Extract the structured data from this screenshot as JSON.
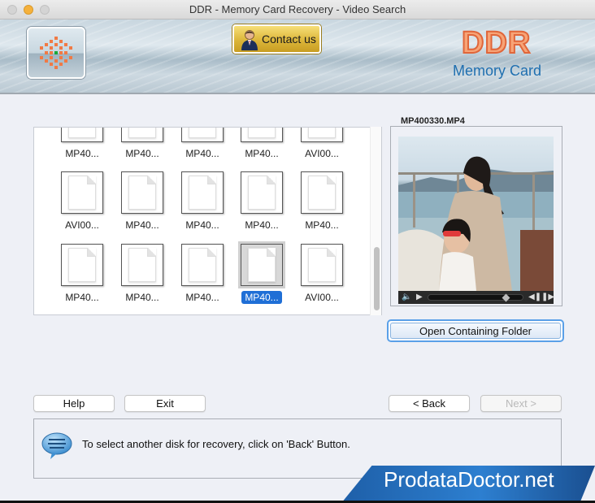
{
  "window": {
    "title": "DDR - Memory Card Recovery - Video Search"
  },
  "header": {
    "contact_label": "Contact us",
    "brand_title": "DDR",
    "brand_subtitle": "Memory Card",
    "brand_color": "#e0663a",
    "subtitle_color": "#1f6fb0"
  },
  "files": {
    "rows": [
      [
        "MP40...",
        "MP40...",
        "MP40...",
        "MP40...",
        "AVI00..."
      ],
      [
        "AVI00...",
        "MP40...",
        "MP40...",
        "MP40...",
        "MP40..."
      ],
      [
        "MP40...",
        "MP40...",
        "MP40...",
        "MP40...",
        "AVI00..."
      ]
    ],
    "selected": {
      "row": 2,
      "col": 3
    },
    "scroll_position": "bottom"
  },
  "preview": {
    "filename": "MP400330.MP4",
    "open_folder_label": "Open Containing Folder",
    "controls": {
      "volume_icon": "speaker-icon",
      "play_icon": "play-icon",
      "prev_icon": "step-back-icon",
      "next_icon": "step-forward-icon",
      "progress_fraction": 0.82
    }
  },
  "buttons": {
    "help": "Help",
    "exit": "Exit",
    "back": "< Back",
    "next": "Next >"
  },
  "message": {
    "text": "To select another disk for recovery, click on 'Back' Button."
  },
  "promo": {
    "text": "ProdataDoctor.net"
  }
}
